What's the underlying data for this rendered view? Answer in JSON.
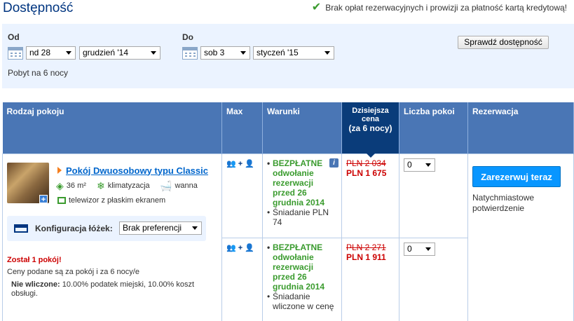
{
  "header": {
    "title": "Dostępność",
    "no_fee_text": "Brak opłat rezerwacyjnych i prowizji za płatność kartą kredytową!",
    "check_icon": "checkmark-icon"
  },
  "search": {
    "from_label": "Od",
    "from_day": "nd 28",
    "from_month": "grudzień '14",
    "to_label": "Do",
    "to_day": "sob 3",
    "to_month": "styczeń '15",
    "check_button": "Sprawdź dostępność",
    "stay_text": "Pobyt na 6 nocy"
  },
  "table": {
    "headers": {
      "room_type": "Rodzaj pokoju",
      "max": "Max",
      "conditions": "Warunki",
      "today_price_small1": "Dzisiejsza",
      "today_price_small2": "cena",
      "today_price_big": "(za 6 nocy)",
      "room_count": "Liczba pokoi",
      "reservation": "Rezerwacja"
    },
    "room": {
      "name": "Pokój Dwuosobowy typu Classic",
      "facilities": {
        "size": "36 m²",
        "ac": "klimatyzacja",
        "bath": "wanna",
        "tv": "telewizor z płaskim ekranem"
      },
      "bed_config_label": "Konfiguracja łóżek:",
      "bed_config_value": "Brak preferencji",
      "warning": "Został 1 pokój!",
      "prices_note": "Ceny podane są za pokój i za 6 nocy/e",
      "not_included_label": "Nie wliczone:",
      "not_included_text": " 10.00% podatek miejski, 10.00% koszt obsługi."
    },
    "rows": [
      {
        "guests": "👥 + 👤",
        "free_cancel": "BEZPŁATNE odwołanie rezerwacji przed 26 grudnia 2014",
        "breakfast": "Śniadanie PLN 74",
        "old_price": "PLN 2 034",
        "new_price": "PLN 1 675",
        "qty": "0"
      },
      {
        "guests": "👥 + 👤",
        "free_cancel": "BEZPŁATNE odwołanie rezerwacji przed 26 grudnia 2014",
        "breakfast": "Śniadanie wliczone w cenę",
        "old_price": "PLN 2 271",
        "new_price": "PLN 1 911",
        "qty": "0"
      }
    ],
    "reserve_button": "Zarezerwuj teraz",
    "instant_text": "Natychmiastowe potwierdzenie"
  }
}
